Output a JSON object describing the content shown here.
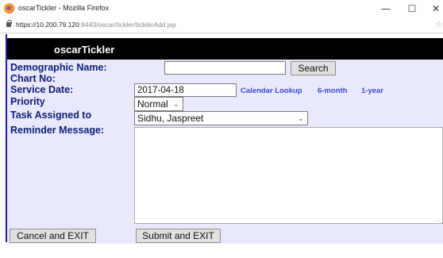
{
  "window": {
    "title": "oscarTickler - Mozilla Firefox",
    "url_host": "https://10.200.79.120",
    "url_rest": ":8443/oscar/tickler/ticklerAdd.jsp",
    "minimize_glyph": "—",
    "maximize_glyph": "☐",
    "close_glyph": "✕",
    "star_glyph": "☆"
  },
  "header": {
    "title": "oscarTickler"
  },
  "form": {
    "demographic_label": "Demographic Name:",
    "demographic_value": "",
    "search_label": "Search",
    "chart_no_label": "Chart No:",
    "service_date_label": "Service Date:",
    "service_date_value": "2017-04-18",
    "calendar_lookup_label": "Calendar Lookup",
    "six_month_label": "6-month",
    "one_year_label": "1-year",
    "priority_label": "Priority",
    "priority_value": "Normal",
    "task_assigned_label": "Task Assigned to",
    "task_assigned_value": "Sidhu, Jaspreet",
    "reminder_label": "Reminder Message:",
    "reminder_value": "",
    "cancel_label": "Cancel and EXIT",
    "submit_label": "Submit and EXIT"
  },
  "icons": {
    "app": "firefox-icon",
    "lock": "lock-icon",
    "dropdown": "chevron-down-icon",
    "bookmark": "star-icon"
  },
  "colors": {
    "label_text": "#0d1b73",
    "form_background": "#e9e9fd",
    "header_background": "#000000",
    "link_text": "#3a4bd0",
    "left_rule": "#1a1ab4"
  }
}
